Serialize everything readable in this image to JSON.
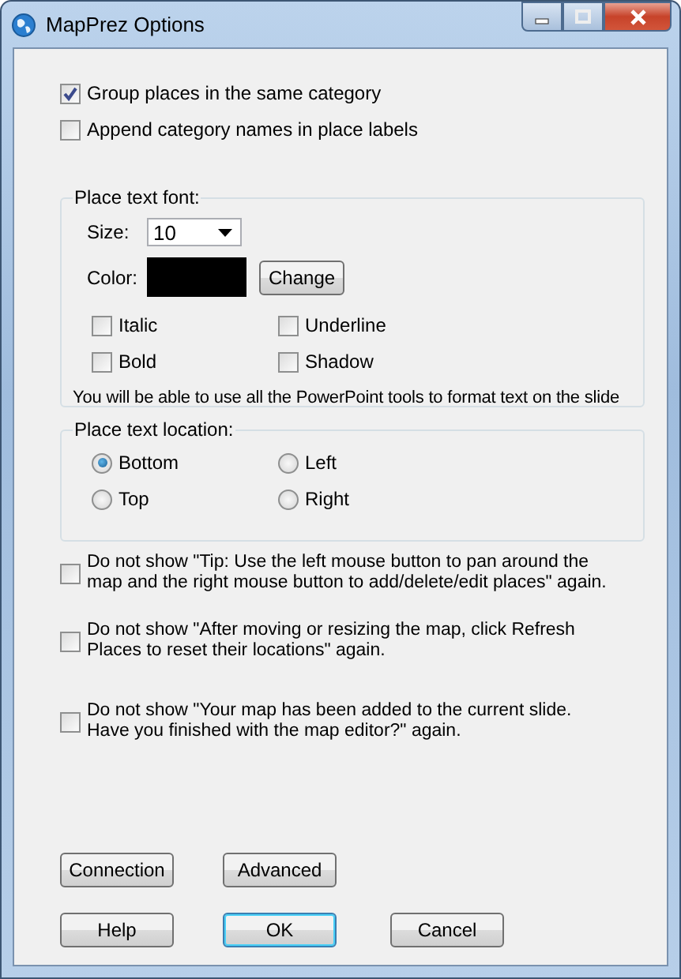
{
  "window": {
    "title": "MapPrez Options"
  },
  "options": [
    {
      "label": "Group places in the same category",
      "checked": true
    },
    {
      "label": "Append category names in place labels",
      "checked": false
    }
  ],
  "font_group": {
    "legend": "Place text font:",
    "size": {
      "label": "Size:",
      "value": "10"
    },
    "color": {
      "label": "Color:",
      "color": "#000000"
    },
    "change_button": "Change",
    "styles": [
      {
        "label": "Italic",
        "checked": false
      },
      {
        "label": "Underline",
        "checked": false
      },
      {
        "label": "Bold",
        "checked": false
      },
      {
        "label": "Shadow",
        "checked": false
      }
    ],
    "note": "You will be able to use all the PowerPoint tools to format text on the slide"
  },
  "location_group": {
    "legend": "Place text location:",
    "options": [
      {
        "label": "Bottom",
        "selected": true
      },
      {
        "label": "Left",
        "selected": false
      },
      {
        "label": "Top",
        "selected": false
      },
      {
        "label": "Right",
        "selected": false
      }
    ]
  },
  "tips": [
    {
      "label": "Do not show \"Tip: Use the left mouse button to pan around the map and the right mouse button to add/delete/edit places\" again.",
      "checked": false
    },
    {
      "label": "Do not show \"After moving or resizing the map, click Refresh Places to reset their locations\" again.",
      "checked": false
    },
    {
      "label": "Do not show \"Your map has been added to the current slide. Have you finished with the map editor?\" again.",
      "checked": false
    }
  ],
  "buttons_row1": [
    {
      "label": "Connection",
      "default": false
    },
    {
      "label": "Advanced",
      "default": false
    }
  ],
  "buttons_row2": [
    {
      "label": "Help",
      "default": false
    },
    {
      "label": "OK",
      "default": true
    },
    {
      "label": "Cancel",
      "default": false
    }
  ]
}
